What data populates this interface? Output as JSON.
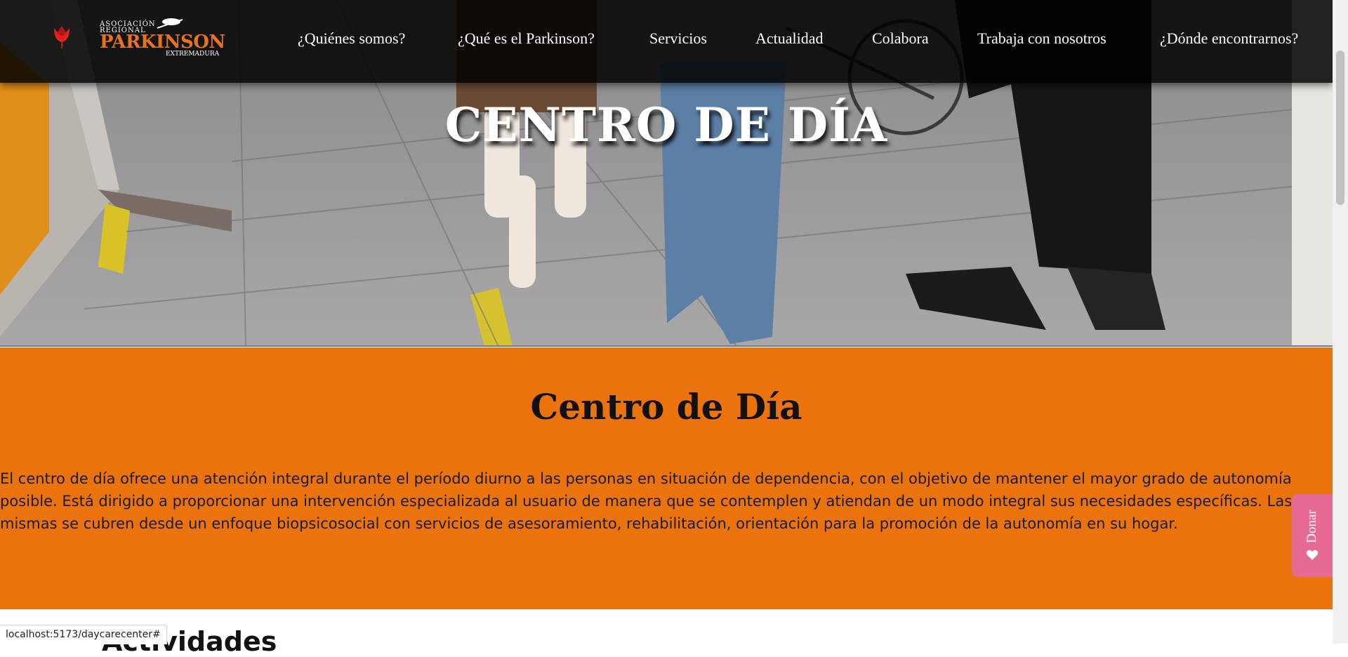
{
  "navbar": {
    "logo": {
      "line1": "ASOCIACIÓN",
      "line2": "REGIONAL",
      "line3": "PARKINSON",
      "line4": "EXTREMADURA"
    },
    "links": [
      {
        "label": "¿Quiénes somos?"
      },
      {
        "label": "¿Qué es el Parkinson?"
      },
      {
        "label": "Servicios"
      },
      {
        "label": "Actualidad"
      },
      {
        "label": "Colabora"
      },
      {
        "label": "Trabaja con nosotros"
      },
      {
        "label": "¿Dónde encontrarnos?"
      }
    ]
  },
  "hero": {
    "title": "CENTRO DE DÍA"
  },
  "intro": {
    "heading": "Centro de Día",
    "paragraph": "El centro de día ofrece una atención integral durante el período diurno a las personas en situación de dependencia, con el objetivo de mantener el mayor grado de autonomía posible. Está dirigido a proporcionar una intervención especializada al usuario de manera que se contemplen y atiendan de un modo integral sus necesidades específicas. Las mismas se cubren desde un enfoque biopsicosocial con servicios de asesoramiento, rehabilitación, orientación para la promoción de la autonomía en su hogar."
  },
  "next_section": {
    "heading": "Actividades"
  },
  "donate": {
    "label": "Donar"
  },
  "status_bar": {
    "url": "localhost:5173/daycarecenter#"
  },
  "colors": {
    "accent_orange": "#ea730d",
    "navbar_bg": "#000000",
    "donate_pink": "#e66a94"
  }
}
